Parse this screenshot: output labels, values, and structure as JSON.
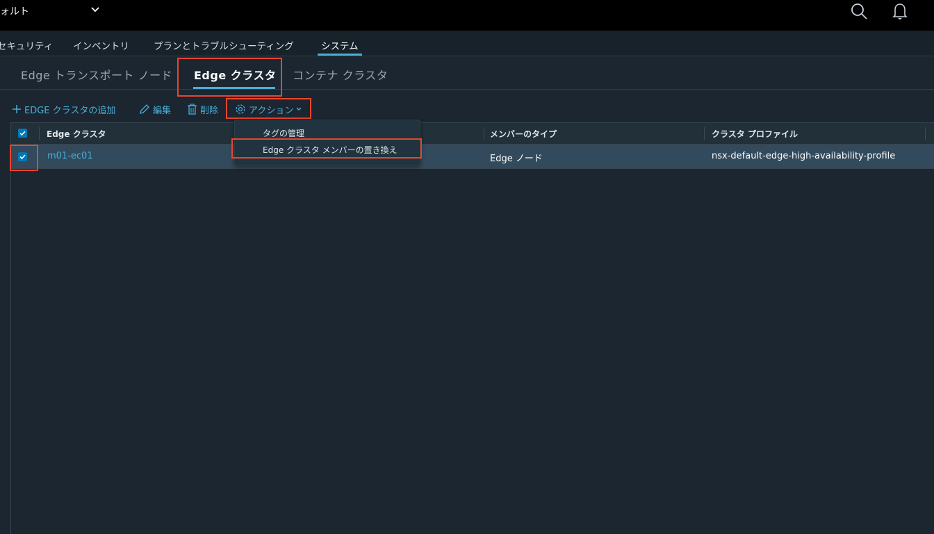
{
  "header": {
    "title": "ォルト",
    "icons": [
      "chevron-down-icon",
      "search-icon",
      "bell-icon"
    ]
  },
  "main_nav": {
    "items": [
      {
        "label": "セキュリティ"
      },
      {
        "label": "インベントリ"
      },
      {
        "label": "プランとトラブルシューティング"
      },
      {
        "label": "システム",
        "active": true
      }
    ]
  },
  "sub_tabs": {
    "items": [
      {
        "label": "Edge トランスポート ノード"
      },
      {
        "label": "Edge クラスタ",
        "active": true
      },
      {
        "label": "コンテナ クラスタ"
      }
    ]
  },
  "toolbar": {
    "add_label": "EDGE クラスタの追加",
    "edit_label": "編集",
    "delete_label": "削除",
    "actions_label": "アクション"
  },
  "actions_menu": {
    "items": [
      {
        "label": "タグの管理"
      },
      {
        "label": "Edge クラスタ メンバーの置き換え"
      }
    ]
  },
  "table": {
    "columns": [
      "Edge クラスタ",
      "メンバーのタイプ",
      "クラスタ プロファイル"
    ],
    "rows": [
      {
        "selected": true,
        "name": "m01-ec01",
        "member_type": "Edge ノード",
        "profile": "nsx-default-edge-high-availability-profile"
      }
    ]
  },
  "colors": {
    "accent": "#49afd9",
    "highlight": "#e8452f",
    "topbar": "#000000",
    "background": "#1b2630",
    "selected_row": "#324a5c"
  }
}
